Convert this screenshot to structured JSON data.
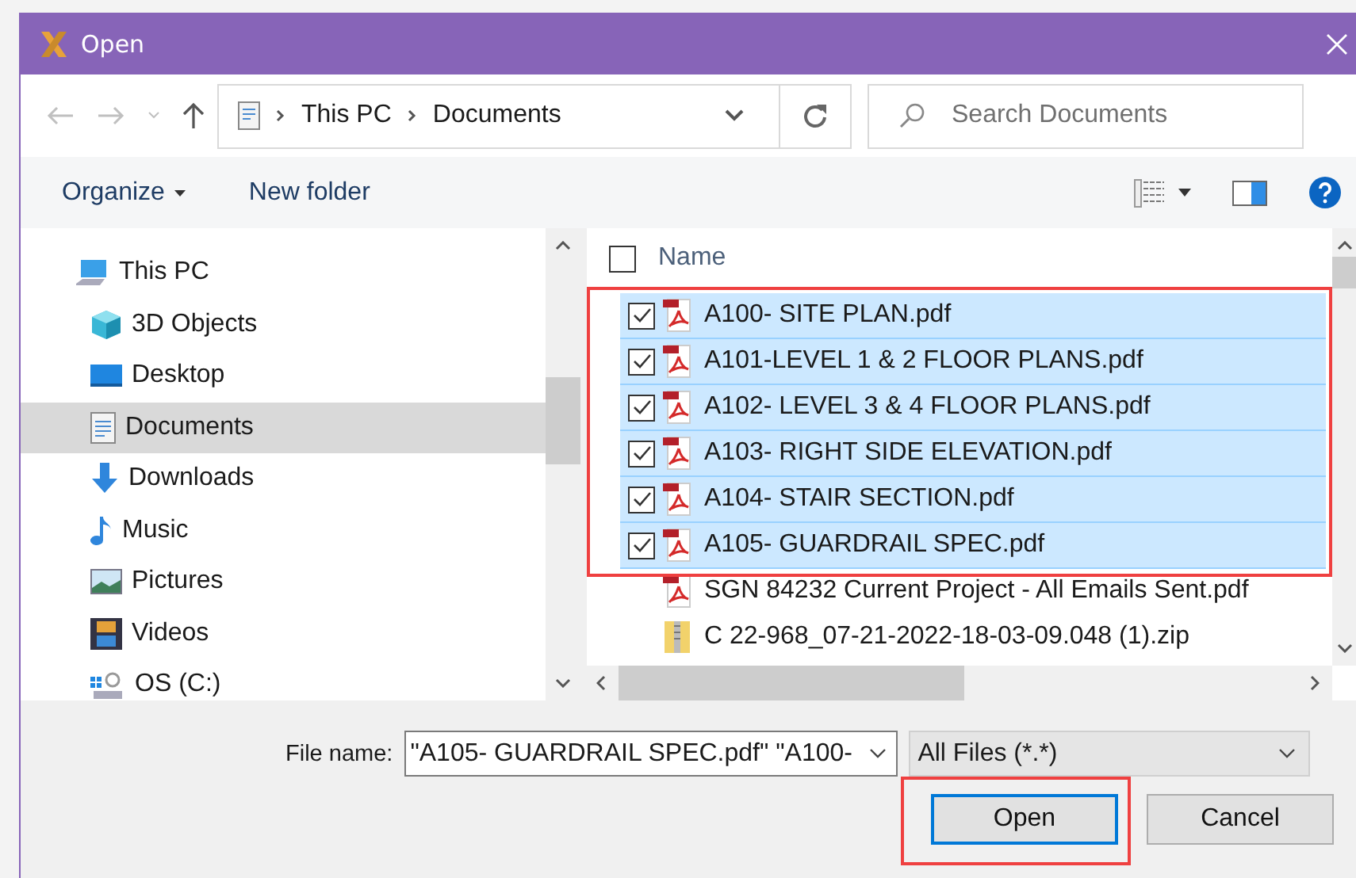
{
  "window": {
    "title": "Open"
  },
  "address": {
    "path": [
      "This PC",
      "Documents"
    ]
  },
  "search": {
    "placeholder": "Search Documents"
  },
  "toolbar": {
    "organize": "Organize",
    "new_folder": "New folder"
  },
  "sidebar": {
    "items": [
      {
        "label": "This PC",
        "selected": false,
        "children": [
          {
            "label": "3D Objects",
            "selected": false
          },
          {
            "label": "Desktop",
            "selected": false
          },
          {
            "label": "Documents",
            "selected": true
          },
          {
            "label": "Downloads",
            "selected": false
          },
          {
            "label": "Music",
            "selected": false
          },
          {
            "label": "Pictures",
            "selected": false
          },
          {
            "label": "Videos",
            "selected": false
          },
          {
            "label": "OS (C:)",
            "selected": false
          }
        ]
      }
    ]
  },
  "file_list": {
    "columns": [
      {
        "label": "Name",
        "checked": false
      }
    ],
    "rows": [
      {
        "name": "A100- SITE PLAN.pdf",
        "kind": "pdf",
        "checked": true,
        "selected": true
      },
      {
        "name": "A101-LEVEL 1 & 2 FLOOR PLANS.pdf",
        "kind": "pdf",
        "checked": true,
        "selected": true
      },
      {
        "name": "A102- LEVEL 3 & 4 FLOOR PLANS.pdf",
        "kind": "pdf",
        "checked": true,
        "selected": true
      },
      {
        "name": "A103- RIGHT SIDE ELEVATION.pdf",
        "kind": "pdf",
        "checked": true,
        "selected": true
      },
      {
        "name": "A104- STAIR SECTION.pdf",
        "kind": "pdf",
        "checked": true,
        "selected": true
      },
      {
        "name": "A105- GUARDRAIL SPEC.pdf",
        "kind": "pdf",
        "checked": true,
        "selected": true
      },
      {
        "name": "SGN 84232 Current Project - All Emails Sent.pdf",
        "kind": "pdf",
        "checked": false,
        "selected": false
      },
      {
        "name": "C 22-968_07-21-2022-18-03-09.048 (1).zip",
        "kind": "zip",
        "checked": false,
        "selected": false
      }
    ]
  },
  "footer": {
    "file_name_label": "File name:",
    "file_name_value": "\"A105- GUARDRAIL SPEC.pdf\" \"A100- ",
    "file_type": "All Files (*.*)",
    "buttons": [
      {
        "label": "Open",
        "kind": "primary"
      },
      {
        "label": "Cancel",
        "kind": "normal"
      }
    ]
  }
}
